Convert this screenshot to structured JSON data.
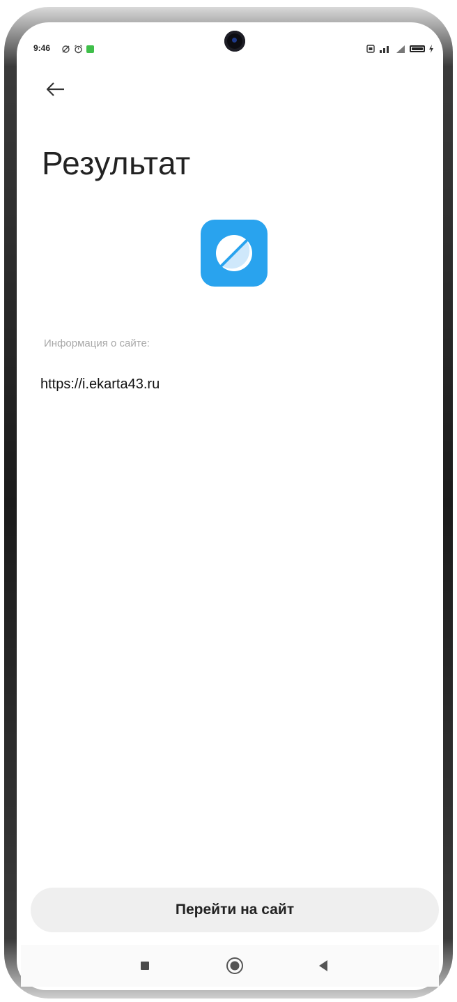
{
  "status_bar": {
    "time": "9:46",
    "left_icons": [
      "sync-icon",
      "alarm-icon",
      "app-notification-icon"
    ],
    "right_icons": [
      "sim-icon",
      "signal-icon",
      "signal-icon",
      "battery-icon",
      "charging-icon"
    ],
    "battery_level": 0.9
  },
  "header": {
    "back_icon": "arrow-left-icon",
    "title": "Результат"
  },
  "content": {
    "app_icon": "browser-icon",
    "app_icon_color": "#29a3ee",
    "info_label": "Информация о сайте:",
    "site_url": "https://i.ekarta43.ru"
  },
  "action": {
    "go_label": "Перейти на сайт"
  },
  "nav_bar": {
    "icons": [
      "recent-apps-icon",
      "home-icon",
      "back-icon"
    ]
  }
}
